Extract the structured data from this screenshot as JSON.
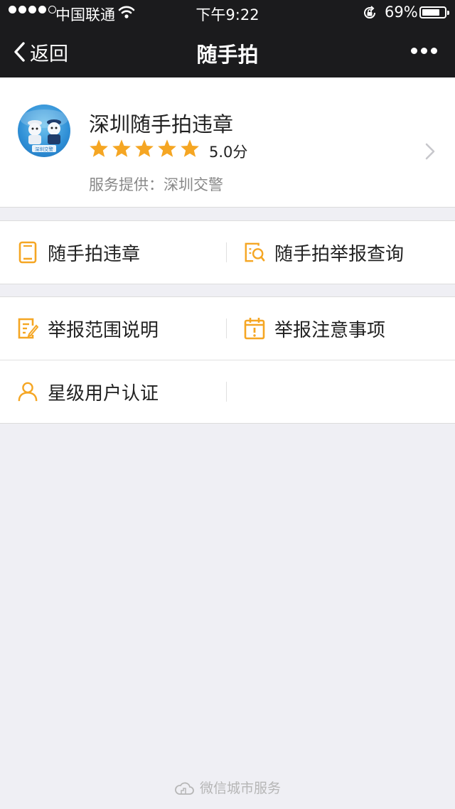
{
  "status_bar": {
    "carrier": "中国联通",
    "time": "下午9:22",
    "battery_percent": "69%"
  },
  "nav": {
    "back_label": "返回",
    "title": "随手拍"
  },
  "app": {
    "name": "深圳随手拍违章",
    "rating": 5,
    "rating_text": "5.0分",
    "provider": "服务提供：深圳交警",
    "avatar_text": "深圳交警"
  },
  "menu": {
    "group1": [
      {
        "label": "随手拍违章",
        "icon": "phone-icon"
      },
      {
        "label": "随手拍举报查询",
        "icon": "document-search-icon"
      }
    ],
    "group2": [
      {
        "label": "举报范围说明",
        "icon": "edit-document-icon"
      },
      {
        "label": "举报注意事项",
        "icon": "calendar-alert-icon"
      },
      {
        "label": "星级用户认证",
        "icon": "user-icon"
      }
    ]
  },
  "footer": {
    "text": "微信城市服务",
    "icon": "cloud-city-icon"
  },
  "colors": {
    "accent": "#f5a623",
    "star": "#f5a623",
    "nav_bg": "#1b1b1d",
    "page_bg": "#efeff4"
  }
}
